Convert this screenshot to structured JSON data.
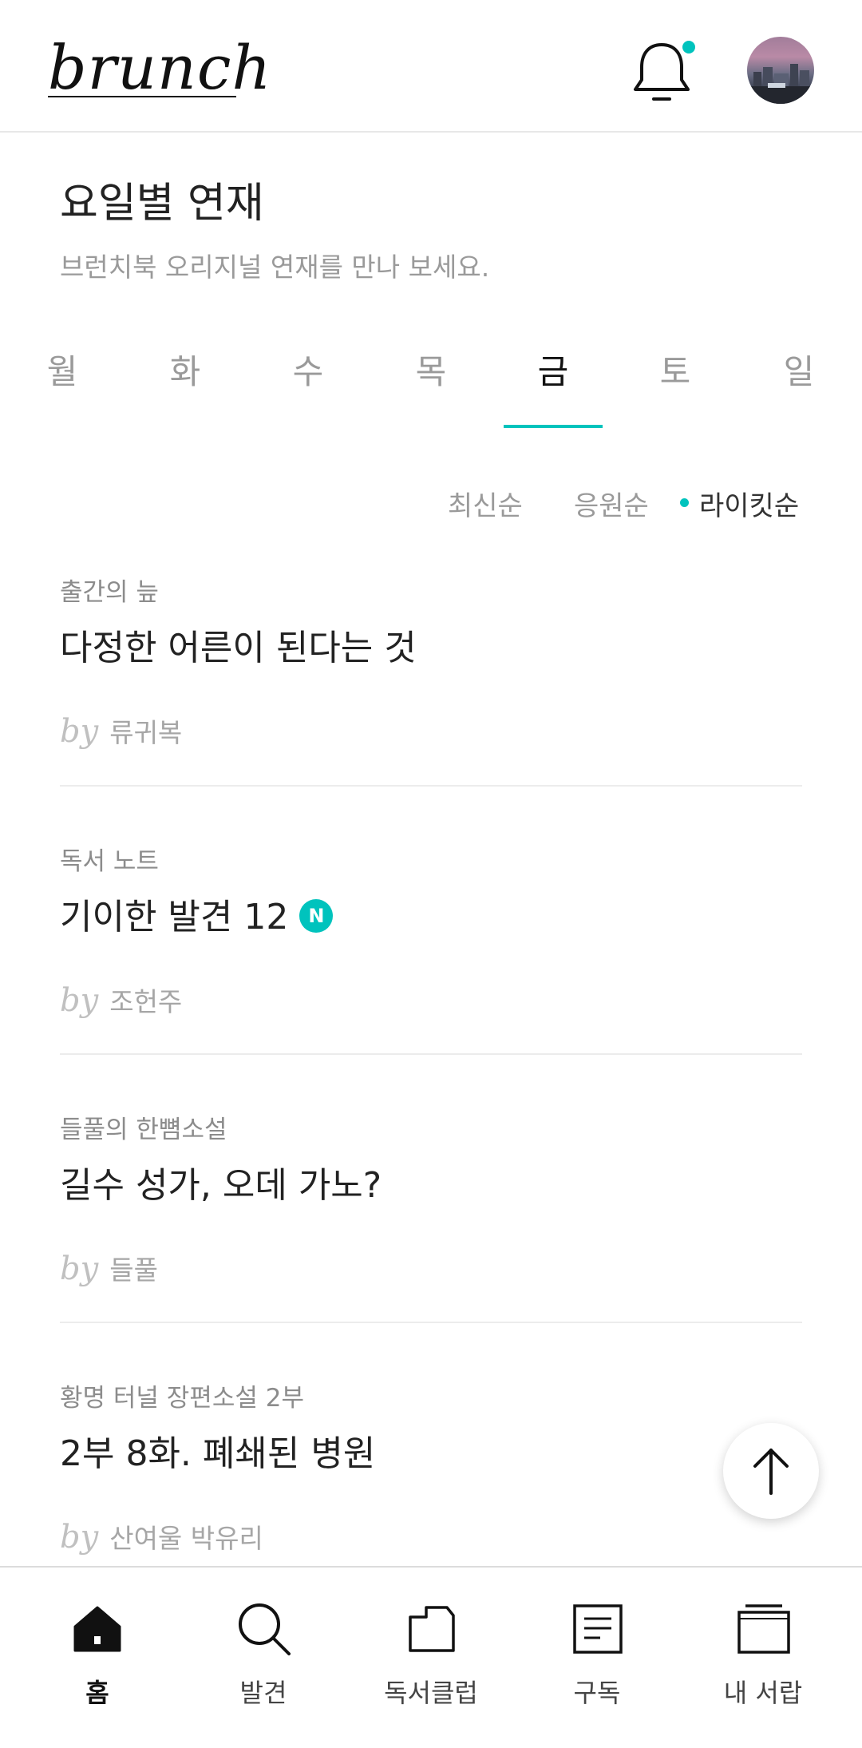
{
  "header": {
    "logo": "brunch",
    "notification_icon": "bell-icon",
    "has_unread": true,
    "avatar_icon": "profile-avatar"
  },
  "section": {
    "title": "요일별 연재",
    "subtitle": "브런치북 오리지널 연재를 만나 보세요."
  },
  "days": [
    {
      "label": "월",
      "active": false
    },
    {
      "label": "화",
      "active": false
    },
    {
      "label": "수",
      "active": false
    },
    {
      "label": "목",
      "active": false
    },
    {
      "label": "금",
      "active": true
    },
    {
      "label": "토",
      "active": false
    },
    {
      "label": "일",
      "active": false
    }
  ],
  "sort": {
    "options": [
      "최신순",
      "응원순",
      "라이킷순"
    ],
    "selected": "라이킷순"
  },
  "items": [
    {
      "category": "출간의 늪",
      "title": "다정한 어른이 된다는 것",
      "by": "by",
      "author": "류귀복",
      "is_new": false
    },
    {
      "category": "독서 노트",
      "title": "기이한 발견 12",
      "by": "by",
      "author": "조헌주",
      "is_new": true,
      "new_badge": "N"
    },
    {
      "category": "들풀의 한뼘소설",
      "title": "길수 성가, 오데 가노?",
      "by": "by",
      "author": "들풀",
      "is_new": false
    },
    {
      "category": "황명 터널 장편소설 2부",
      "title": "2부 8화. 폐쇄된 병원",
      "by": "by",
      "author": "산여울 박유리",
      "is_new": false
    }
  ],
  "scroll_top_icon": "arrow-up-icon",
  "bottom_nav": [
    {
      "label": "홈",
      "icon": "home-icon",
      "active": true
    },
    {
      "label": "발견",
      "icon": "search-icon",
      "active": false
    },
    {
      "label": "독서클럽",
      "icon": "folder-icon",
      "active": false
    },
    {
      "label": "구독",
      "icon": "document-icon",
      "active": false
    },
    {
      "label": "내 서랍",
      "icon": "drawer-icon",
      "active": false
    }
  ],
  "colors": {
    "accent": "#00c3bd",
    "text_primary": "#222222",
    "text_secondary": "#9a9a9a"
  }
}
